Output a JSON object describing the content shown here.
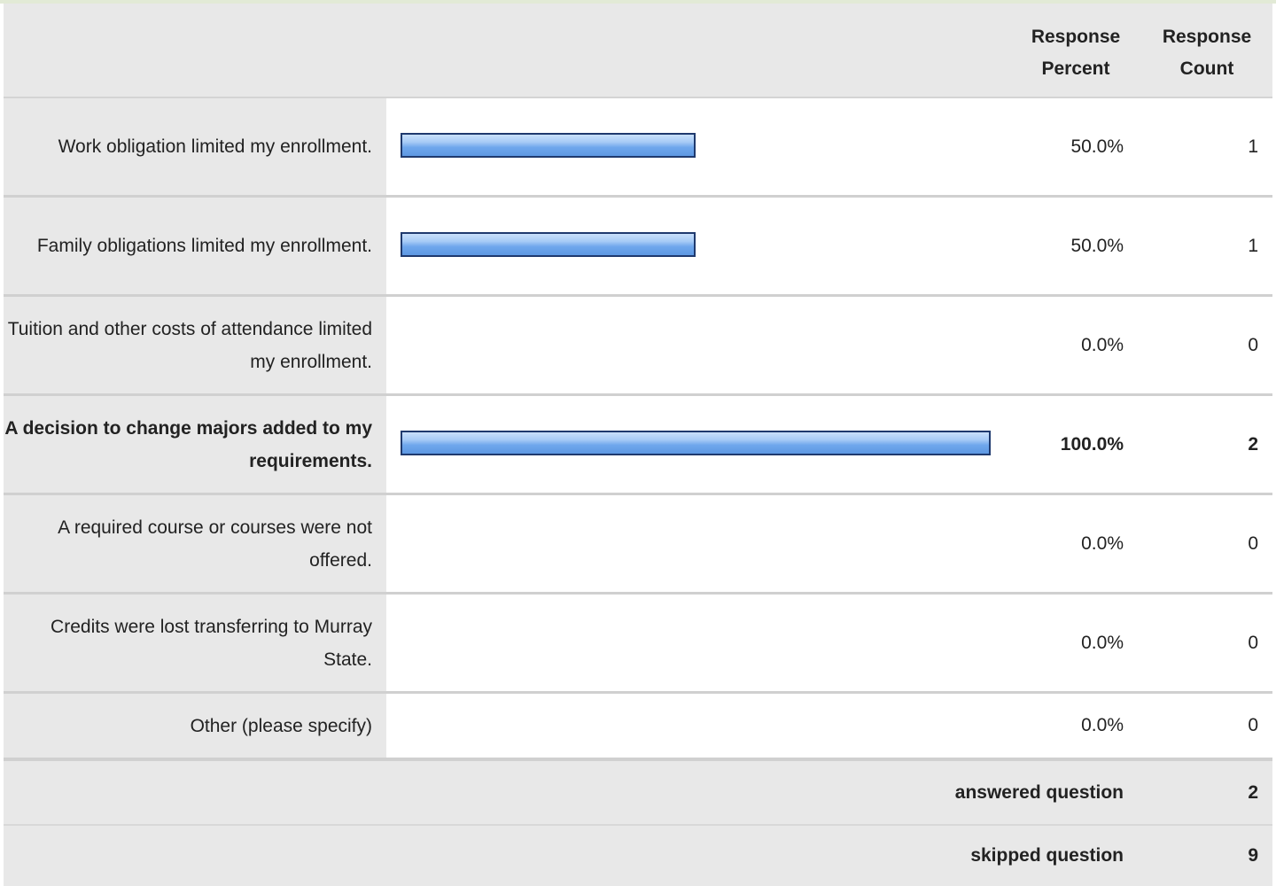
{
  "header": {
    "response_percent": "Response Percent",
    "response_count": "Response Count"
  },
  "chart_data": {
    "type": "bar",
    "orientation": "horizontal",
    "categories": [
      "Work obligation limited my enrollment.",
      "Family obligations limited my enrollment.",
      "Tuition and other costs of attendance limited my enrollment.",
      "A decision to change majors added to my requirements.",
      "A required course or courses were not offered.",
      "Credits were lost transferring to Murray State.",
      "Other (please specify)"
    ],
    "values": [
      50.0,
      50.0,
      0.0,
      100.0,
      0.0,
      0.0,
      0.0
    ],
    "xlim": [
      0,
      100
    ],
    "bar_color": "#6fa7ec"
  },
  "rows": [
    {
      "label": "Work obligation limited my enrollment.",
      "percent": "50.0%",
      "count": "1",
      "bold": false
    },
    {
      "label": "Family obligations limited my enrollment.",
      "percent": "50.0%",
      "count": "1",
      "bold": false
    },
    {
      "label": "Tuition and other costs of attendance limited my enrollment.",
      "percent": "0.0%",
      "count": "0",
      "bold": false
    },
    {
      "label": "A decision to change majors added to my requirements.",
      "percent": "100.0%",
      "count": "2",
      "bold": true
    },
    {
      "label": "A required course or courses were not offered.",
      "percent": "0.0%",
      "count": "0",
      "bold": false
    },
    {
      "label": "Credits were lost transferring to Murray State.",
      "percent": "0.0%",
      "count": "0",
      "bold": false
    },
    {
      "label": "Other (please specify)",
      "percent": "0.0%",
      "count": "0",
      "bold": false
    }
  ],
  "summary": {
    "answered_label": "answered question",
    "answered_value": "2",
    "skipped_label": "skipped question",
    "skipped_value": "9"
  }
}
